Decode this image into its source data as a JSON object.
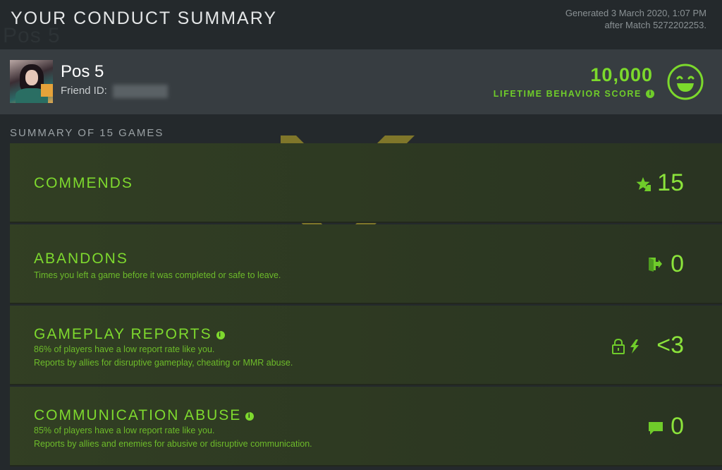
{
  "header": {
    "title": "YOUR CONDUCT SUMMARY",
    "ghost_name": "Pos 5",
    "generated_line1": "Generated 3 March 2020, 1:07 PM",
    "generated_line2": "after Match 5272202253."
  },
  "profile": {
    "name": "Pos 5",
    "friend_id_label": "Friend ID:",
    "behavior_score": "10,000",
    "behavior_score_label": "LIFETIME BEHAVIOR SCORE",
    "info_glyph": "i",
    "score_icon": "smiley-face-icon"
  },
  "summary": {
    "heading": "SUMMARY OF 15 GAMES",
    "cards": [
      {
        "title": "COMMENDS",
        "desc1": "",
        "desc2": "",
        "value": "15",
        "icon": "star-icon"
      },
      {
        "title": "ABANDONS",
        "desc1": "Times you left a game before it was completed or safe to leave.",
        "desc2": "",
        "value": "0",
        "icon": "exit-door-icon"
      },
      {
        "title": "GAMEPLAY REPORTS",
        "desc1": "86% of players have a low report rate like you.",
        "desc2": "Reports by allies for disruptive gameplay, cheating or MMR abuse.",
        "value": "<3",
        "icon": "lock-lightning-icon"
      },
      {
        "title": "COMMUNICATION ABUSE",
        "desc1": "85% of players have a low report rate like you.",
        "desc2": "Reports by allies and enemies for abusive or disruptive communication.",
        "value": "0",
        "icon": "chat-bubble-icon"
      }
    ]
  },
  "colors": {
    "accent_green": "#7ed92e",
    "background": "#24292c",
    "profile_bar": "#373d41",
    "watermark_gold": "#b3a32a"
  }
}
